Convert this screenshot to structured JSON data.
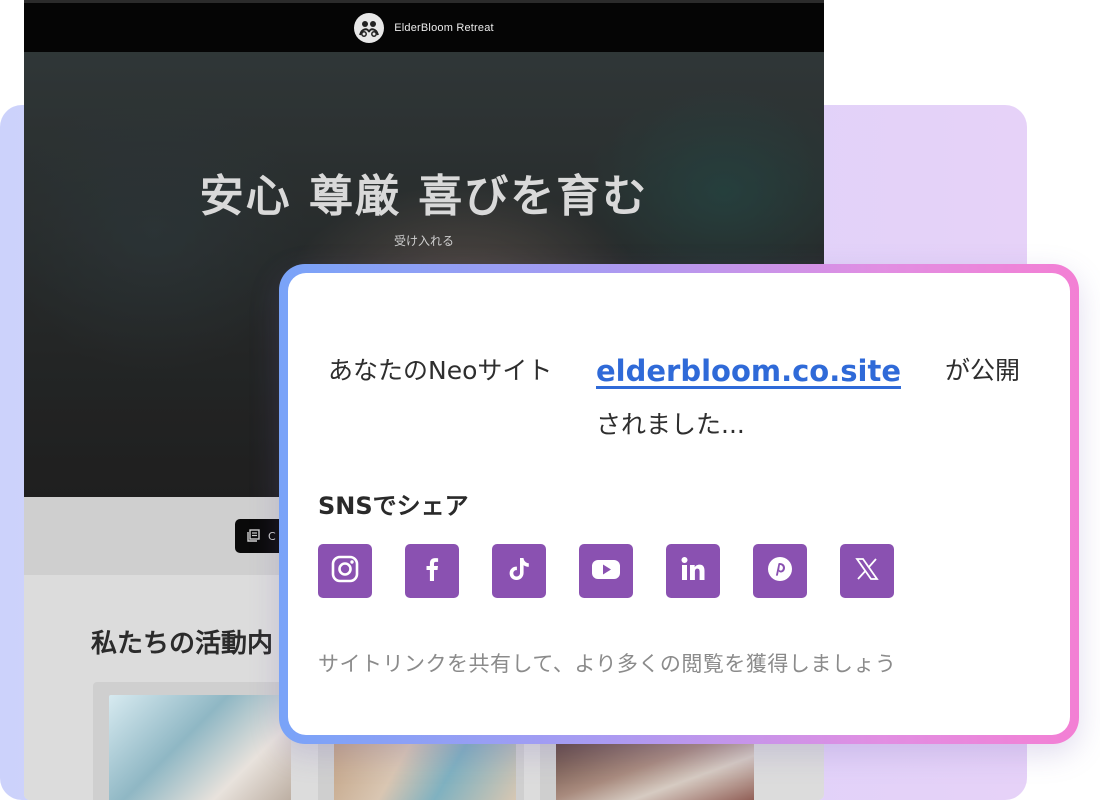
{
  "site": {
    "brand": "ElderBloom Retreat",
    "hero_title": "安心 尊厳 喜びを育む",
    "hero_subtitle": "受け入れる",
    "cta_label": "C",
    "section_title": "私たちの活動内"
  },
  "modal": {
    "publish_prefix": "あなたのNeoサイト",
    "site_url": "elderbloom.co.site",
    "publish_suffix": "が公開",
    "publish_continuation": "されました...",
    "share_heading": "SNSでシェア",
    "hint": "サイトリンクを共有して、より多くの閲覧を獲得しましょう",
    "social": [
      {
        "name": "instagram",
        "icon": "instagram-icon"
      },
      {
        "name": "facebook",
        "icon": "facebook-icon"
      },
      {
        "name": "tiktok",
        "icon": "tiktok-icon"
      },
      {
        "name": "youtube",
        "icon": "youtube-icon"
      },
      {
        "name": "linkedin",
        "icon": "linkedin-icon"
      },
      {
        "name": "pinterest",
        "icon": "pinterest-icon"
      },
      {
        "name": "x",
        "icon": "x-icon"
      }
    ]
  },
  "colors": {
    "social_bg": "#8a51b1",
    "link": "#2f6ad8",
    "frame_start": "#79a3f8",
    "frame_end": "#f37fd4"
  }
}
